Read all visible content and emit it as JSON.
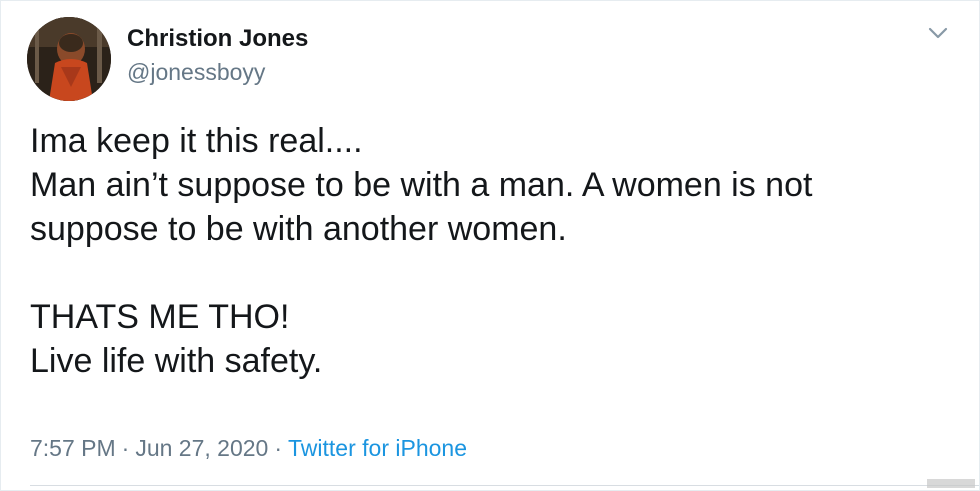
{
  "author": {
    "name": "Christion Jones",
    "handle": "@jonessboyy",
    "avatar_icon": "profile-photo"
  },
  "tweet": {
    "lines": [
      "Ima keep it this real....",
      "Man ain’t suppose to be with a man. A women is not",
      "suppose to be with another women."
    ],
    "lines_after_break": [
      "THATS ME THO!",
      "Live life with safety."
    ]
  },
  "meta": {
    "time": "7:57 PM",
    "separator": "·",
    "date": "Jun 27, 2020",
    "source": "Twitter for iPhone"
  },
  "colors": {
    "text": "#14171a",
    "muted": "#657786",
    "link": "#1b95e0"
  },
  "menu_icon": "chevron-down-icon"
}
